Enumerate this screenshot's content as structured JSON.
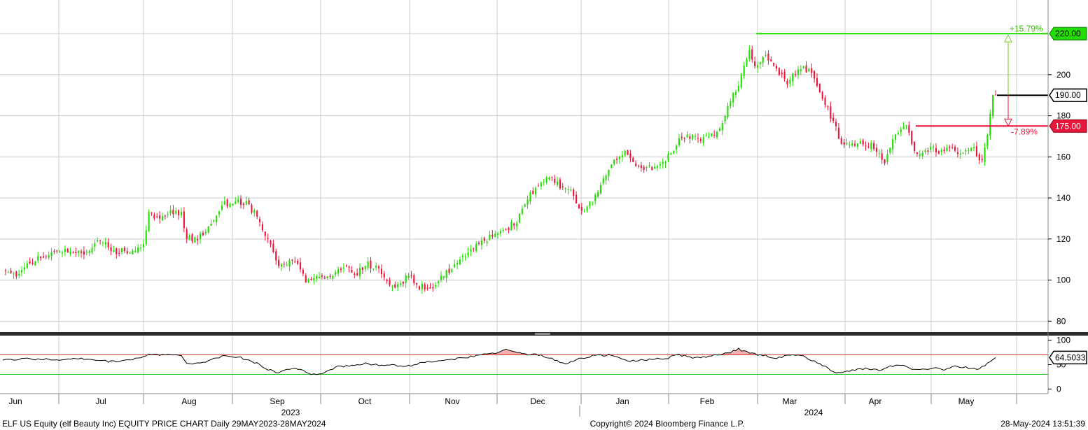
{
  "chart_data": {
    "type": "candlestick",
    "price_axis": {
      "ylim": [
        75,
        235
      ],
      "ticks": [
        80,
        100,
        120,
        140,
        160,
        180,
        200
      ],
      "grid": true
    },
    "rsi_axis": {
      "ylim": [
        -8,
        108
      ],
      "ticks": [
        0,
        50,
        100
      ],
      "upper_level": 70,
      "lower_level": 30
    },
    "x_ticks": [
      "Jun",
      "Jul",
      "Aug",
      "Sep",
      "Oct",
      "Nov",
      "Dec",
      "Jan",
      "Feb",
      "Mar",
      "Apr",
      "May"
    ],
    "years": [
      "2023",
      "2024"
    ],
    "colors": {
      "up": "#22dd00",
      "down": "#e8163a",
      "rsi_upper": "#e03030",
      "rsi_lower": "#22cc22",
      "grid": "#cccccc"
    },
    "levels": {
      "high": {
        "value": 220.0,
        "label": "220.00",
        "pct": "+15.79%"
      },
      "last": {
        "value": 190.0,
        "label": "190.00"
      },
      "low": {
        "value": 175.0,
        "label": "175.00",
        "pct": "-7.89%"
      }
    },
    "rsi_last": "64.5033",
    "close_anchors": [
      [
        0,
        105
      ],
      [
        6,
        103
      ],
      [
        12,
        110
      ],
      [
        18,
        112
      ],
      [
        24,
        115
      ],
      [
        30,
        113
      ],
      [
        36,
        119
      ],
      [
        42,
        114
      ],
      [
        48,
        114
      ],
      [
        52,
        118
      ],
      [
        54,
        133
      ],
      [
        58,
        130
      ],
      [
        62,
        133
      ],
      [
        66,
        132
      ],
      [
        68,
        120
      ],
      [
        72,
        120
      ],
      [
        78,
        130
      ],
      [
        82,
        137
      ],
      [
        86,
        138
      ],
      [
        90,
        137
      ],
      [
        94,
        131
      ],
      [
        98,
        120
      ],
      [
        102,
        106
      ],
      [
        108,
        110
      ],
      [
        112,
        100
      ],
      [
        116,
        101
      ],
      [
        122,
        103
      ],
      [
        126,
        107
      ],
      [
        130,
        102
      ],
      [
        134,
        108
      ],
      [
        138,
        106
      ],
      [
        142,
        99
      ],
      [
        146,
        97
      ],
      [
        150,
        102
      ],
      [
        154,
        97
      ],
      [
        158,
        96
      ],
      [
        162,
        102
      ],
      [
        166,
        105
      ],
      [
        172,
        114
      ],
      [
        176,
        117
      ],
      [
        180,
        121
      ],
      [
        186,
        125
      ],
      [
        190,
        129
      ],
      [
        194,
        140
      ],
      [
        198,
        146
      ],
      [
        202,
        150
      ],
      [
        206,
        146
      ],
      [
        210,
        143
      ],
      [
        214,
        133
      ],
      [
        218,
        138
      ],
      [
        222,
        150
      ],
      [
        226,
        158
      ],
      [
        230,
        162
      ],
      [
        234,
        154
      ],
      [
        238,
        155
      ],
      [
        242,
        155
      ],
      [
        246,
        160
      ],
      [
        250,
        168
      ],
      [
        254,
        170
      ],
      [
        258,
        168
      ],
      [
        262,
        170
      ],
      [
        266,
        176
      ],
      [
        268,
        184
      ],
      [
        272,
        196
      ],
      [
        276,
        212
      ],
      [
        278,
        205
      ],
      [
        282,
        208
      ],
      [
        286,
        203
      ],
      [
        290,
        195
      ],
      [
        294,
        204
      ],
      [
        298,
        202
      ],
      [
        302,
        193
      ],
      [
        306,
        180
      ],
      [
        310,
        167
      ],
      [
        314,
        166
      ],
      [
        318,
        167
      ],
      [
        322,
        165
      ],
      [
        326,
        158
      ],
      [
        330,
        172
      ],
      [
        334,
        174
      ],
      [
        338,
        160
      ],
      [
        342,
        164
      ],
      [
        346,
        163
      ],
      [
        350,
        165
      ],
      [
        354,
        161
      ],
      [
        358,
        165
      ],
      [
        362,
        158
      ],
      [
        364,
        172
      ],
      [
        366,
        190
      ],
      [
        367,
        190
      ]
    ],
    "rsi_anchors": [
      [
        0,
        60
      ],
      [
        10,
        62
      ],
      [
        20,
        60
      ],
      [
        30,
        62
      ],
      [
        36,
        58
      ],
      [
        40,
        56
      ],
      [
        46,
        60
      ],
      [
        52,
        65
      ],
      [
        54,
        72
      ],
      [
        60,
        70
      ],
      [
        66,
        68
      ],
      [
        68,
        52
      ],
      [
        72,
        52
      ],
      [
        76,
        58
      ],
      [
        82,
        68
      ],
      [
        88,
        64
      ],
      [
        94,
        52
      ],
      [
        98,
        40
      ],
      [
        102,
        34
      ],
      [
        106,
        40
      ],
      [
        110,
        42
      ],
      [
        114,
        30
      ],
      [
        118,
        33
      ],
      [
        124,
        46
      ],
      [
        130,
        48
      ],
      [
        134,
        53
      ],
      [
        140,
        48
      ],
      [
        144,
        50
      ],
      [
        148,
        45
      ],
      [
        152,
        50
      ],
      [
        156,
        55
      ],
      [
        162,
        58
      ],
      [
        170,
        63
      ],
      [
        176,
        70
      ],
      [
        182,
        74
      ],
      [
        186,
        80
      ],
      [
        192,
        72
      ],
      [
        198,
        70
      ],
      [
        204,
        60
      ],
      [
        208,
        50
      ],
      [
        212,
        60
      ],
      [
        218,
        68
      ],
      [
        224,
        70
      ],
      [
        228,
        63
      ],
      [
        232,
        58
      ],
      [
        240,
        60
      ],
      [
        246,
        64
      ],
      [
        250,
        70
      ],
      [
        256,
        64
      ],
      [
        262,
        68
      ],
      [
        268,
        74
      ],
      [
        272,
        82
      ],
      [
        276,
        73
      ],
      [
        282,
        68
      ],
      [
        286,
        62
      ],
      [
        290,
        70
      ],
      [
        296,
        68
      ],
      [
        300,
        56
      ],
      [
        304,
        46
      ],
      [
        308,
        33
      ],
      [
        312,
        35
      ],
      [
        316,
        40
      ],
      [
        320,
        42
      ],
      [
        324,
        38
      ],
      [
        328,
        46
      ],
      [
        332,
        50
      ],
      [
        336,
        42
      ],
      [
        340,
        40
      ],
      [
        344,
        44
      ],
      [
        348,
        40
      ],
      [
        352,
        48
      ],
      [
        356,
        44
      ],
      [
        360,
        40
      ],
      [
        364,
        52
      ],
      [
        367,
        64.5
      ]
    ]
  },
  "footer": {
    "left": "ELF US Equity (elf Beauty Inc) EQUITY PRICE CHART  Daily 29MAY2023-28MAY2024",
    "center": "Copyright© 2024 Bloomberg Finance L.P.",
    "right": "28-May-2024 13:51:39"
  }
}
